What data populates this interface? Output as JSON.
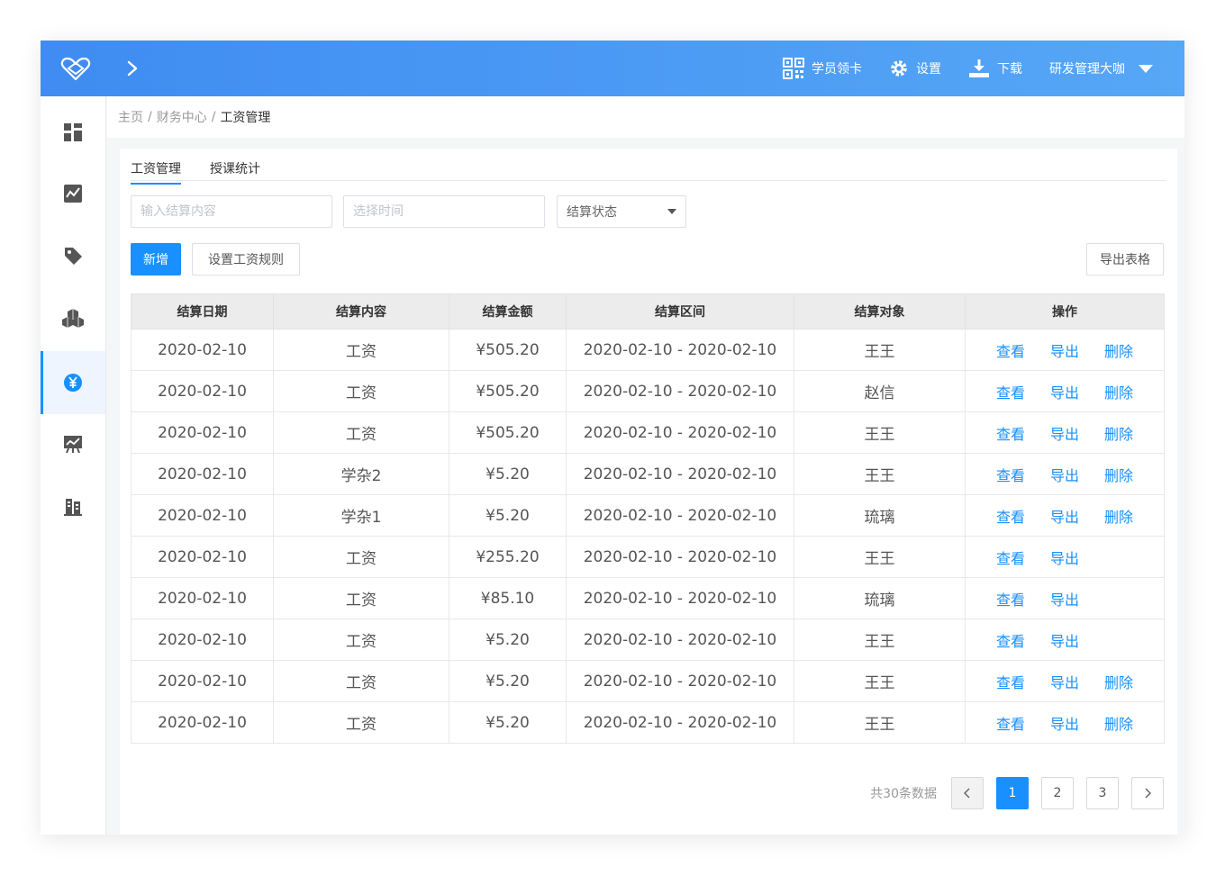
{
  "topbar": {
    "items": [
      {
        "label": "学员领卡",
        "icon": "qrcode-icon"
      },
      {
        "label": "设置",
        "icon": "gear-icon"
      },
      {
        "label": "下载",
        "icon": "download-icon"
      }
    ],
    "user_name": "研发管理大咖"
  },
  "sidebar": {
    "items": [
      {
        "icon": "dashboard-icon",
        "active": false
      },
      {
        "icon": "chart-icon",
        "active": false
      },
      {
        "icon": "tag-icon",
        "active": false
      },
      {
        "icon": "cubes-icon",
        "active": false
      },
      {
        "icon": "yen-icon",
        "active": true
      },
      {
        "icon": "trend-icon",
        "active": false
      },
      {
        "icon": "building-icon",
        "active": false
      }
    ]
  },
  "breadcrumb": [
    "主页",
    "财务中心",
    "工资管理"
  ],
  "tabs": [
    "工资管理",
    "授课统计"
  ],
  "filters": {
    "content_placeholder": "输入结算内容",
    "time_placeholder": "选择时间",
    "status_label": "结算状态"
  },
  "buttons": {
    "add": "新增",
    "rules": "设置工资规则",
    "export_table": "导出表格"
  },
  "table": {
    "headers": [
      "结算日期",
      "结算内容",
      "结算金额",
      "结算区间",
      "结算对象",
      "操作"
    ],
    "ops": {
      "view": "查看",
      "export": "导出",
      "delete": "删除"
    },
    "rows": [
      {
        "date": "2020-02-10",
        "content": "工资",
        "amount": "¥505.20",
        "range": "2020-02-10 - 2020-02-10",
        "target": "王王",
        "deletable": true
      },
      {
        "date": "2020-02-10",
        "content": "工资",
        "amount": "¥505.20",
        "range": "2020-02-10 - 2020-02-10",
        "target": "赵信",
        "deletable": true
      },
      {
        "date": "2020-02-10",
        "content": "工资",
        "amount": "¥505.20",
        "range": "2020-02-10 - 2020-02-10",
        "target": "王王",
        "deletable": true
      },
      {
        "date": "2020-02-10",
        "content": "学杂2",
        "amount": "¥5.20",
        "range": "2020-02-10 - 2020-02-10",
        "target": "王王",
        "deletable": true
      },
      {
        "date": "2020-02-10",
        "content": "学杂1",
        "amount": "¥5.20",
        "range": "2020-02-10 - 2020-02-10",
        "target": "琉璃",
        "deletable": true
      },
      {
        "date": "2020-02-10",
        "content": "工资",
        "amount": "¥255.20",
        "range": "2020-02-10 - 2020-02-10",
        "target": "王王",
        "deletable": false
      },
      {
        "date": "2020-02-10",
        "content": "工资",
        "amount": "¥85.10",
        "range": "2020-02-10 - 2020-02-10",
        "target": "琉璃",
        "deletable": false
      },
      {
        "date": "2020-02-10",
        "content": "工资",
        "amount": "¥5.20",
        "range": "2020-02-10 - 2020-02-10",
        "target": "王王",
        "deletable": false
      },
      {
        "date": "2020-02-10",
        "content": "工资",
        "amount": "¥5.20",
        "range": "2020-02-10 - 2020-02-10",
        "target": "王王",
        "deletable": true
      },
      {
        "date": "2020-02-10",
        "content": "工资",
        "amount": "¥5.20",
        "range": "2020-02-10 - 2020-02-10",
        "target": "王王",
        "deletable": true
      }
    ]
  },
  "pagination": {
    "total_text": "共30条数据",
    "pages": [
      "1",
      "2",
      "3"
    ],
    "current": "1"
  },
  "colors": {
    "accent": "#1890ff",
    "topbar_start": "#3f8cf2",
    "topbar_end": "#56a7f6"
  }
}
